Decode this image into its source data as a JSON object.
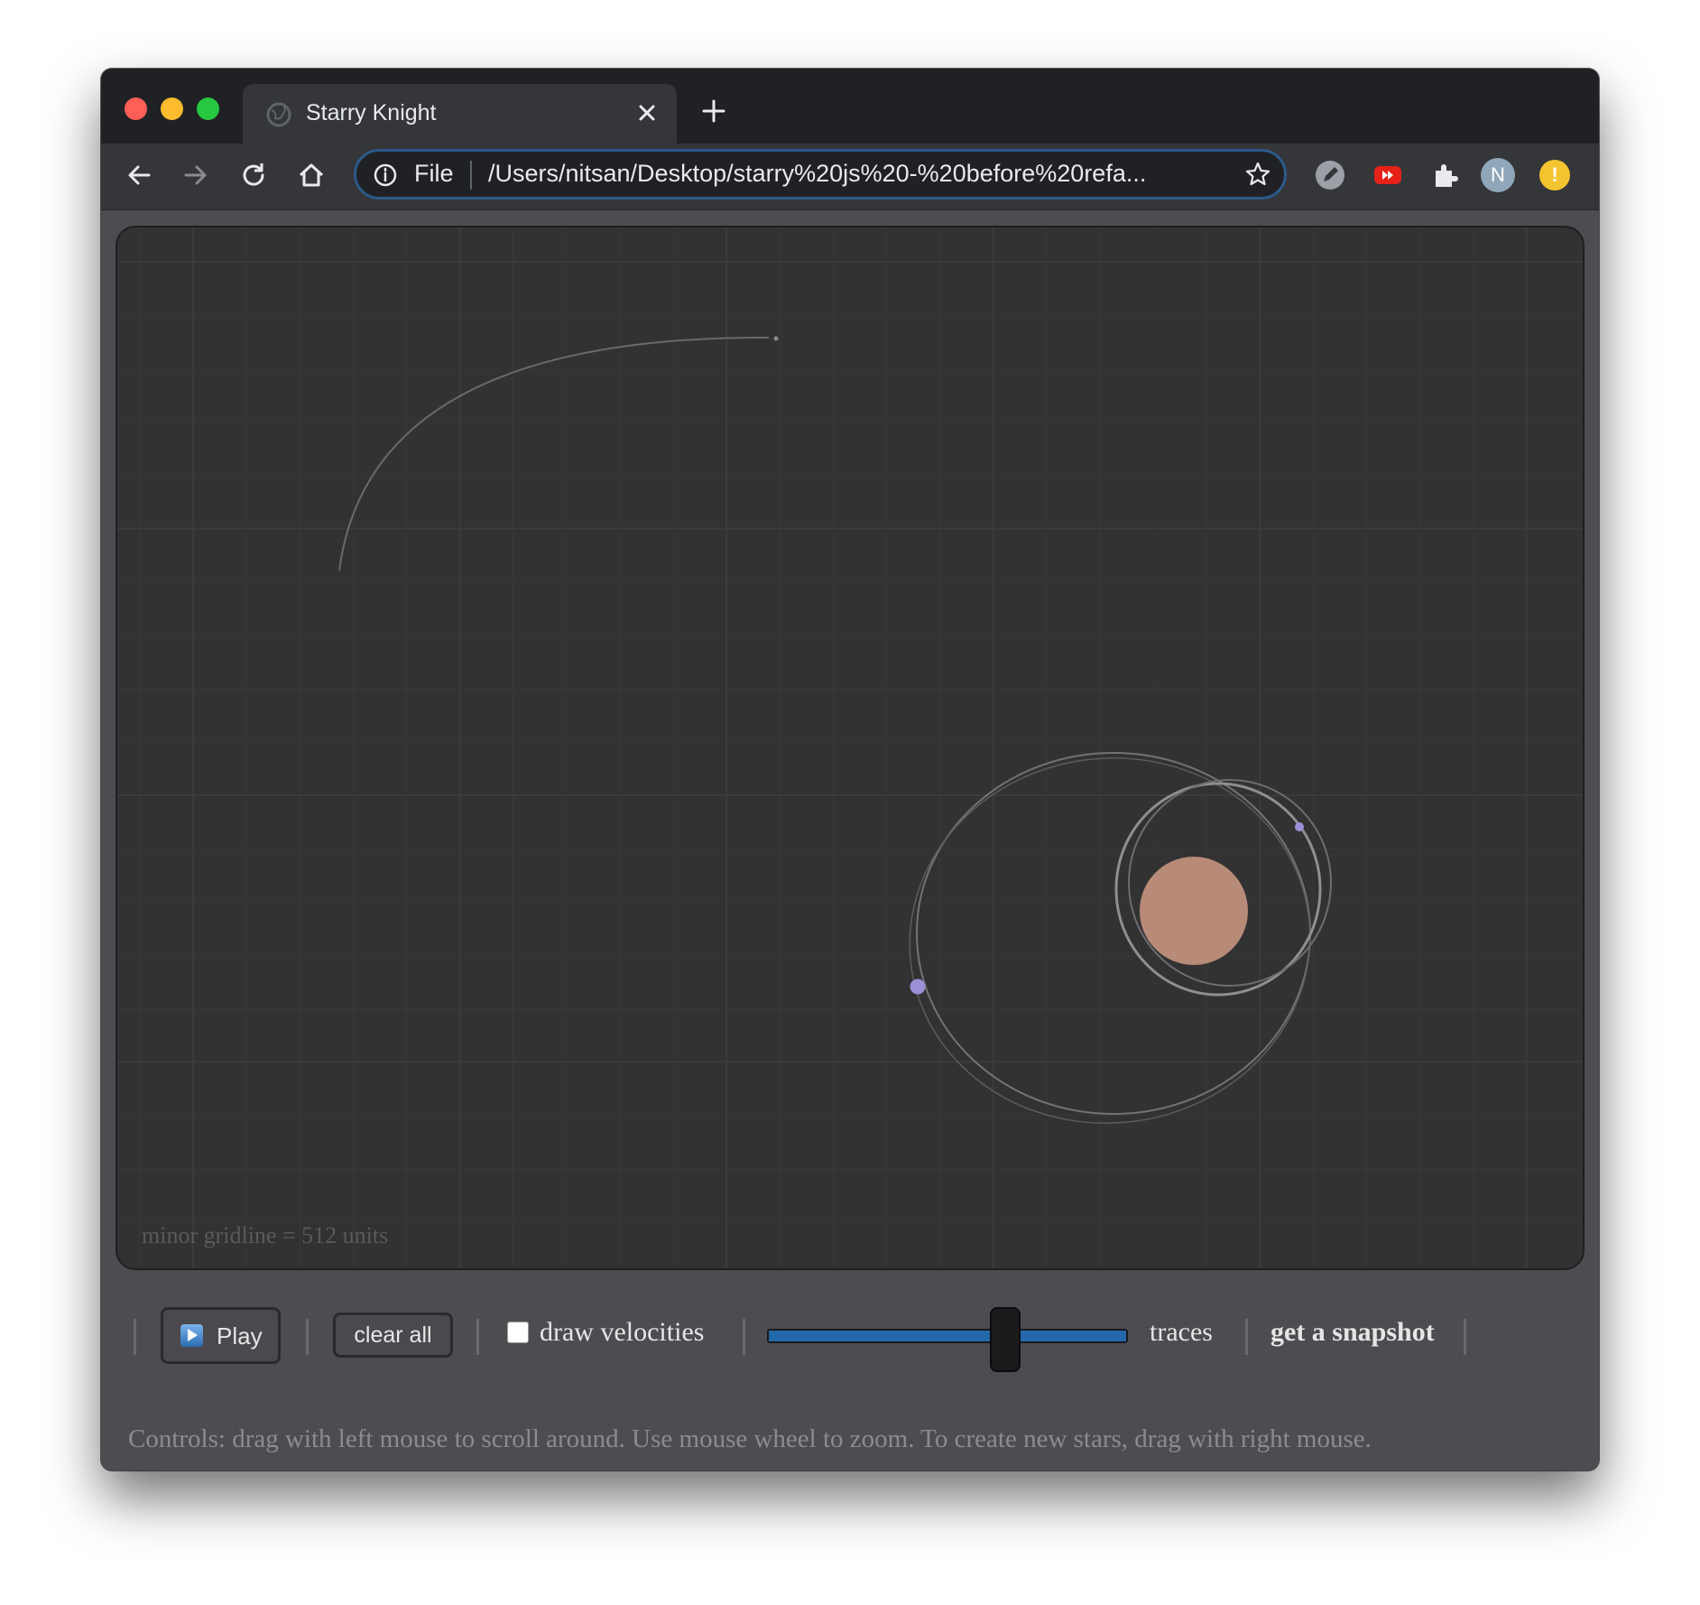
{
  "browser": {
    "tab_title": "Starry Knight",
    "address_scheme": "File",
    "address_url": "/Users/nitsan/Desktop/starry%20js%20-%20before%20refa...",
    "profile_initial": "N",
    "alert_glyph": "!"
  },
  "canvas": {
    "scale_label": "minor gridline = 512 units",
    "background_color": "#333233",
    "gridline_color": "#3d3c3e",
    "star_color": "#b88a78",
    "planet_color": "#9b8fd6",
    "orbit_color": "#8a8a8a"
  },
  "controls": {
    "play_label": "Play",
    "clear_label": "clear all",
    "draw_velocities_label": "draw velocities",
    "draw_velocities_checked": false,
    "traces_label": "traces",
    "traces_level": 0.66,
    "snapshot_label": "get a snapshot"
  },
  "help_text": "Controls: drag with left mouse to scroll around. Use mouse wheel to zoom. To create new stars, drag with right mouse."
}
